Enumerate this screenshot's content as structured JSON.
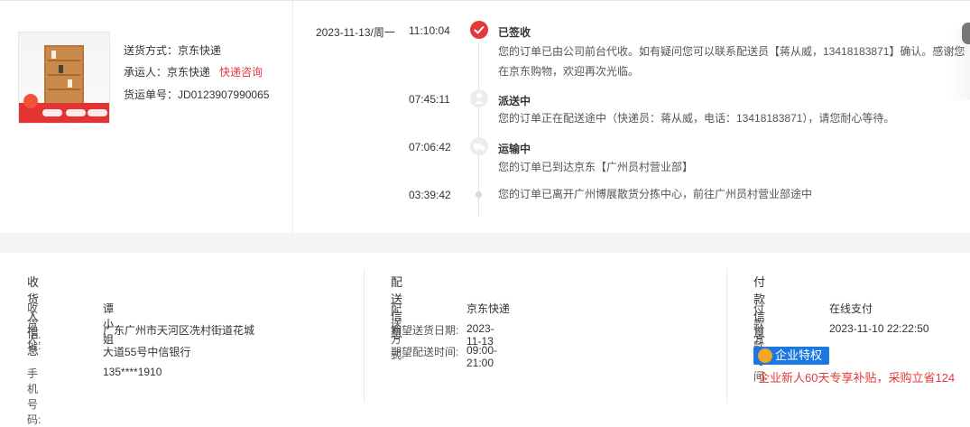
{
  "shipment": {
    "delivery_label": "送货方式：",
    "delivery_value": "京东快递",
    "carrier_label": "承运人：",
    "carrier_value": "京东快递",
    "carrier_link": "快递咨询",
    "waybill_label": "货运单号：",
    "waybill_value": "JD0123907990065"
  },
  "timeline": [
    {
      "date": "2023-11-13/周一",
      "time": "11:10:04",
      "title": "已签收",
      "desc": "您的订单已由公司前台代收。如有疑问您可以联系配送员【蒋从威，13418183871】确认。感谢您在京东购物，欢迎再次光临。",
      "icon": "check-icon",
      "active": true
    },
    {
      "date": "",
      "time": "07:45:11",
      "title": "派送中",
      "desc": "您的订单正在配送途中（快递员：蒋从威，电话：13418183871），请您耐心等待。",
      "icon": "delivery-person-icon",
      "active": false
    },
    {
      "date": "",
      "time": "07:06:42",
      "title": "运输中",
      "desc": "您的订单已到达京东【广州员村营业部】",
      "icon": "truck-icon",
      "active": false
    },
    {
      "date": "",
      "time": "03:39:42",
      "title": "",
      "desc": "您的订单已离开广州博展散货分拣中心，前往广州员村营业部途中",
      "icon": "dot-icon",
      "active": false
    }
  ],
  "receiver": {
    "title": "收货人信息",
    "name_label": "收货人:",
    "name_value": "谭小姐",
    "address_label": "地址:",
    "address_line1": "广东广州市天河区冼村街道花城",
    "address_line2": "大道55号中信银行",
    "phone_label": "手机号码:",
    "phone_value": "135****1910"
  },
  "delivery": {
    "title": "配送信息",
    "method_label": "配送方式:",
    "method_value": "京东快递",
    "date_label": "期望送货日期:",
    "date_value": "2023-11-13",
    "time_label": "期望配送时间:",
    "time_value": "09:00-21:00"
  },
  "payment": {
    "title": "付款信息",
    "method_label": "付款方式:",
    "method_value": "在线支付",
    "time_label": "付款时间:",
    "time_value": "2023-11-10 22:22:50",
    "badge": "企业特权",
    "promo": "企业新人60天专享补贴，采购立省124"
  },
  "colors": {
    "accent": "#e4393c",
    "badge": "#1b78e0"
  }
}
